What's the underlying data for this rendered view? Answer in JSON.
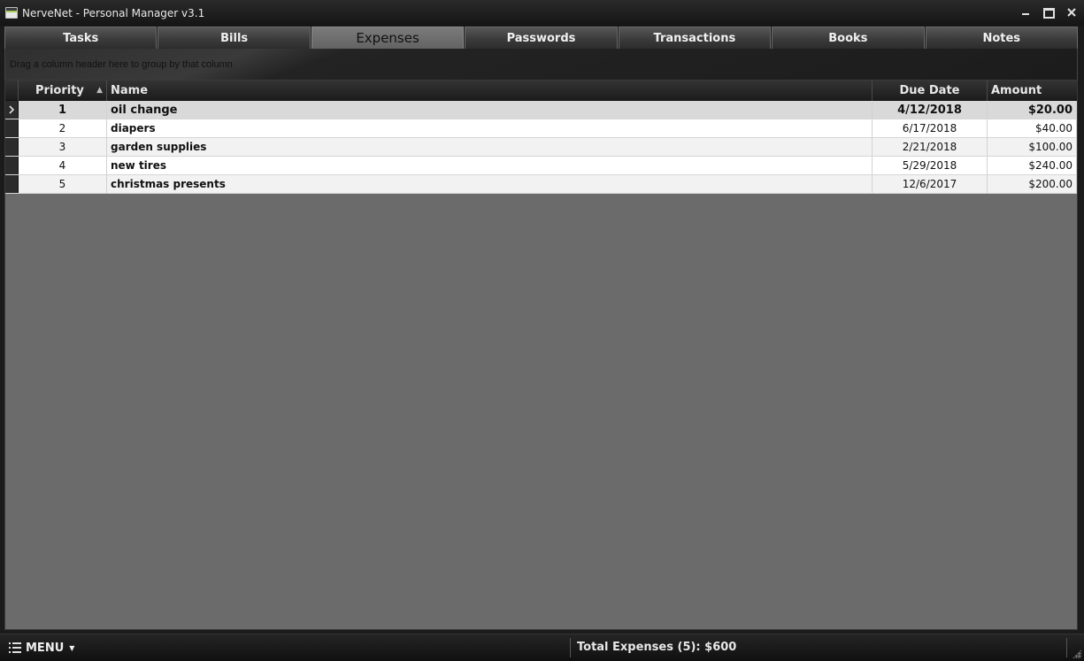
{
  "window": {
    "title": "NerveNet - Personal Manager v3.1"
  },
  "tabs": [
    {
      "label": "Tasks"
    },
    {
      "label": "Bills"
    },
    {
      "label": "Expenses",
      "active": true
    },
    {
      "label": "Passwords"
    },
    {
      "label": "Transactions"
    },
    {
      "label": "Books"
    },
    {
      "label": "Notes"
    }
  ],
  "group_panel": {
    "hint": "Drag a column header here to group by that column"
  },
  "grid": {
    "columns": {
      "priority": "Priority",
      "name": "Name",
      "due_date": "Due Date",
      "amount": "Amount"
    },
    "sort": {
      "column": "priority",
      "direction": "ascending"
    },
    "rows": [
      {
        "priority": "1",
        "name": "oil change",
        "due_date": "4/12/2018",
        "amount": "$20.00",
        "selected": true
      },
      {
        "priority": "2",
        "name": "diapers",
        "due_date": "6/17/2018",
        "amount": "$40.00"
      },
      {
        "priority": "3",
        "name": "garden supplies",
        "due_date": "2/21/2018",
        "amount": "$100.00"
      },
      {
        "priority": "4",
        "name": "new tires",
        "due_date": "5/29/2018",
        "amount": "$240.00"
      },
      {
        "priority": "5",
        "name": "christmas presents",
        "due_date": "12/6/2017",
        "amount": "$200.00"
      }
    ]
  },
  "statusbar": {
    "menu_label": "MENU",
    "total_text": "Total Expenses (5): $600"
  },
  "icons": {
    "app": "app-icon",
    "minimize": "minimize-icon",
    "maximize": "maximize-icon",
    "close": "close-icon",
    "sort": "sort-ascending-icon",
    "row_indicator": "chevron-right-icon",
    "menu": "list-icon",
    "menu_caret": "caret-down-icon",
    "resize": "resize-grip-icon"
  }
}
